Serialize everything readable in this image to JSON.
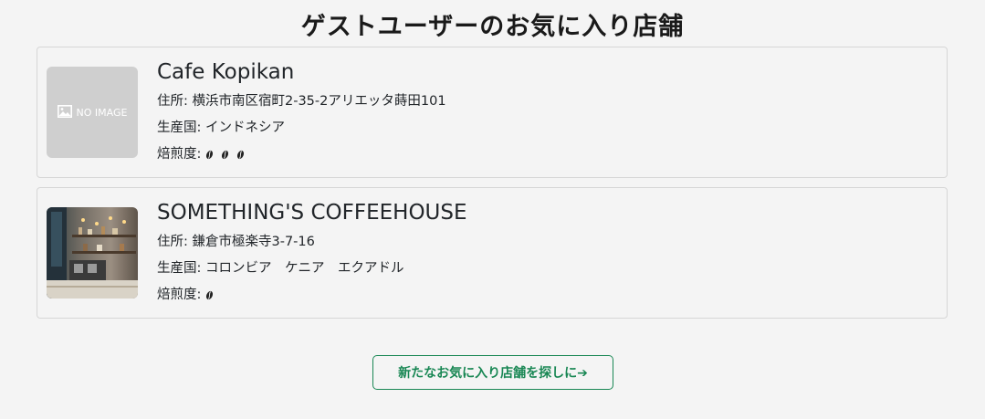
{
  "header": {
    "title": "ゲストユーザーのお気に入り店舗"
  },
  "shops": [
    {
      "name": "Cafe Kopikan",
      "image": "NO IMAGE",
      "address_label": "住所: ",
      "address": "横浜市南区宿町2-35-2アリエッタ蒔田101",
      "origin_label": "生産国: ",
      "origin": "インドネシア",
      "roast_label": "焙煎度: ",
      "roast_level": 3
    },
    {
      "name": "SOMETHING'S COFFEEHOUSE",
      "address_label": "住所: ",
      "address": "鎌倉市極楽寺3-7-16",
      "origin_label": "生産国: ",
      "origin": "コロンビア　ケニア　エクアドル",
      "roast_label": "焙煎度: ",
      "roast_level": 1
    }
  ],
  "actions": {
    "find_more": "新たなお気に入り店舗を探しに➔"
  },
  "colors": {
    "accent": "#198754",
    "background": "#f4f4f4",
    "placeholder": "#cfcfcf"
  }
}
